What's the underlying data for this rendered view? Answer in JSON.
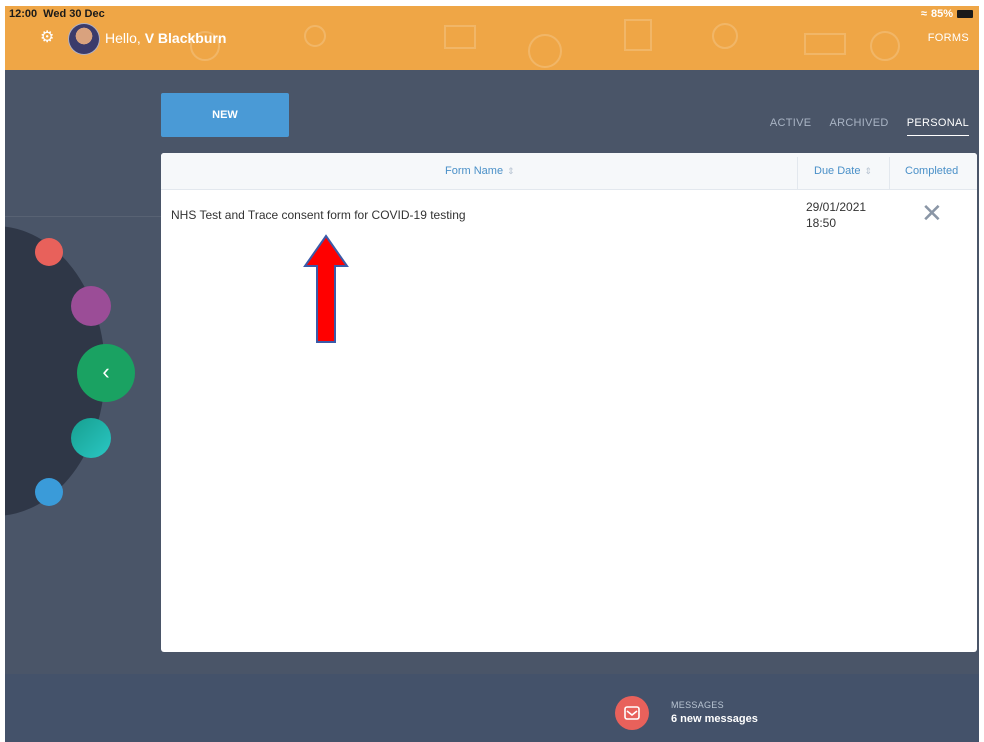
{
  "status_bar": {
    "time": "12:00",
    "date": "Wed 30 Dec",
    "battery": "85%"
  },
  "header": {
    "greeting": "Hello,",
    "user_name": "V Blackburn",
    "nav_label": "FORMS"
  },
  "toolbar": {
    "new_label": "NEW"
  },
  "tabs": [
    {
      "label": "ACTIVE",
      "active": false
    },
    {
      "label": "ARCHIVED",
      "active": false
    },
    {
      "label": "PERSONAL",
      "active": true
    }
  ],
  "table": {
    "columns": {
      "form_name": "Form Name",
      "due_date": "Due Date",
      "completed": "Completed"
    },
    "rows": [
      {
        "form_name": "NHS Test and Trace consent form for COVID-19 testing",
        "due_date": "29/01/2021",
        "due_time": "18:50",
        "completed_icon": "x-icon"
      }
    ]
  },
  "footer": {
    "messages_title": "MESSAGES",
    "messages_count": "6 new messages"
  },
  "colors": {
    "header": "#efa646",
    "accent": "#4a9ad6",
    "background": "#4a5568",
    "arrow": "#ff0000"
  }
}
